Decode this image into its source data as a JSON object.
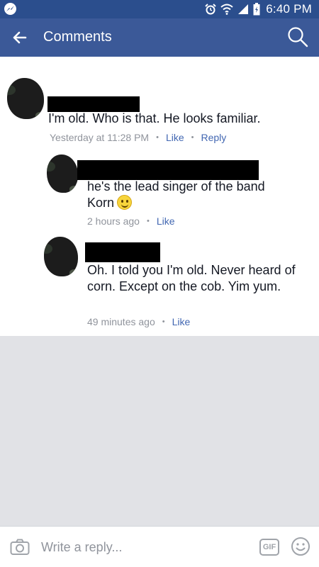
{
  "status_bar": {
    "time": "6:40 PM"
  },
  "app_bar": {
    "title": "Comments"
  },
  "comments": [
    {
      "text": "I'm old. Who is that. He looks familiar.",
      "time": "Yesterday at 11:28 PM",
      "like": "Like",
      "reply": "Reply"
    },
    {
      "text": "he's the lead singer of the band Korn",
      "time": "2 hours ago",
      "like": "Like"
    },
    {
      "text": "Oh. I told you I'm old. Never heard of corn. Except on the cob. Yim yum.",
      "time": "49 minutes ago",
      "like": "Like"
    }
  ],
  "composer": {
    "placeholder": "Write a reply...",
    "gif_label": "GIF"
  },
  "colors": {
    "status_bar": "#2b4e8d",
    "app_bar": "#3b5998",
    "link": "#4267b2",
    "meta": "#90949c",
    "empty_area": "#e1e2e6"
  }
}
